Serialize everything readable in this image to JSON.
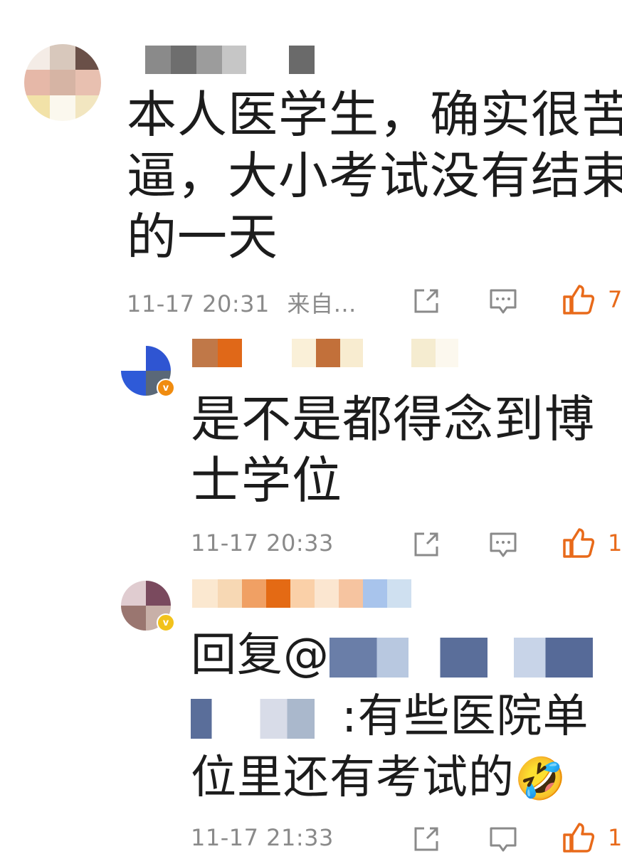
{
  "comments": [
    {
      "text_lines": [
        "本人医学生，确实很苦",
        "逼，大小考试没有结束",
        "的一天"
      ],
      "timestamp": "11-17 20:31",
      "source": "来自…",
      "likes": "7"
    },
    {
      "text_lines": [
        "是不是都得念到博",
        "士学位"
      ],
      "timestamp": "11-17 20:33",
      "likes": "1"
    },
    {
      "text_lines": [
        "回复@",
        ":有些医院单",
        "位里还有考试的"
      ],
      "timestamp": "11-17 21:33",
      "likes": "1",
      "emoji": "🤣"
    }
  ],
  "icons": {
    "share": "share-icon",
    "comment": "comment-icon",
    "like": "thumbs-up-icon",
    "badge": "verified-badge-icon"
  },
  "colors": {
    "like": "#e86a1a",
    "meta": "#8a8a8a",
    "badge": "#f0a020"
  }
}
